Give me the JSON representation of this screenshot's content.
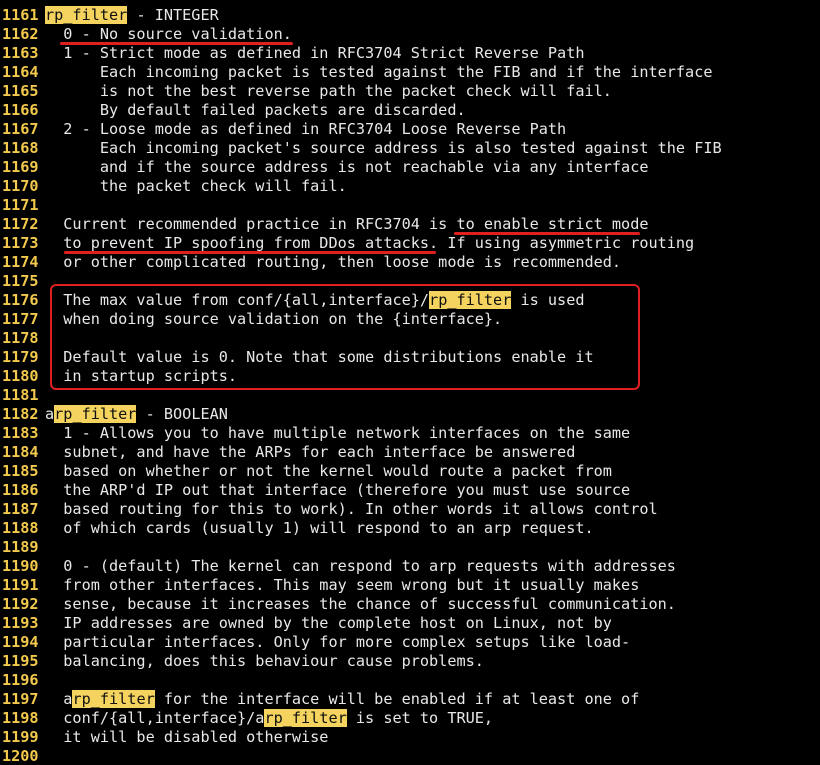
{
  "editor": {
    "accent_line_number_color": "#f2c94c",
    "highlight_color": "#f4d35e",
    "annotation_color": "#e02020",
    "lines": [
      {
        "num": "1161",
        "segments": [
          {
            "t": "rp_filter",
            "hl": true
          },
          {
            "t": " - INTEGER"
          }
        ]
      },
      {
        "num": "1162",
        "segments": [
          {
            "t": "  0 - No source validation."
          }
        ]
      },
      {
        "num": "1163",
        "segments": [
          {
            "t": "  1 - Strict mode as defined in RFC3704 Strict Reverse Path"
          }
        ]
      },
      {
        "num": "1164",
        "segments": [
          {
            "t": "      Each incoming packet is tested against the FIB and if the interface"
          }
        ]
      },
      {
        "num": "1165",
        "segments": [
          {
            "t": "      is not the best reverse path the packet check will fail."
          }
        ]
      },
      {
        "num": "1166",
        "segments": [
          {
            "t": "      By default failed packets are discarded."
          }
        ]
      },
      {
        "num": "1167",
        "segments": [
          {
            "t": "  2 - Loose mode as defined in RFC3704 Loose Reverse Path"
          }
        ]
      },
      {
        "num": "1168",
        "segments": [
          {
            "t": "      Each incoming packet's source address is also tested against the FIB"
          }
        ]
      },
      {
        "num": "1169",
        "segments": [
          {
            "t": "      and if the source address is not reachable via any interface"
          }
        ]
      },
      {
        "num": "1170",
        "segments": [
          {
            "t": "      the packet check will fail."
          }
        ]
      },
      {
        "num": "1171",
        "segments": [
          {
            "t": ""
          }
        ]
      },
      {
        "num": "1172",
        "segments": [
          {
            "t": "  Current recommended practice in RFC3704 is to enable strict mode"
          }
        ]
      },
      {
        "num": "1173",
        "segments": [
          {
            "t": "  to prevent IP spoofing from DDos attacks. If using asymmetric routing"
          }
        ]
      },
      {
        "num": "1174",
        "segments": [
          {
            "t": "  or other complicated routing, then loose mode is recommended."
          }
        ]
      },
      {
        "num": "1175",
        "segments": [
          {
            "t": ""
          }
        ]
      },
      {
        "num": "1176",
        "segments": [
          {
            "t": "  The max value from conf/{all,interface}/"
          },
          {
            "t": "rp_filter",
            "hl": true
          },
          {
            "t": " is used"
          }
        ]
      },
      {
        "num": "1177",
        "segments": [
          {
            "t": "  when doing source validation on the {interface}."
          }
        ]
      },
      {
        "num": "1178",
        "segments": [
          {
            "t": ""
          }
        ]
      },
      {
        "num": "1179",
        "segments": [
          {
            "t": "  Default value is 0. Note that some distributions enable it"
          }
        ]
      },
      {
        "num": "1180",
        "segments": [
          {
            "t": "  in startup scripts."
          }
        ]
      },
      {
        "num": "1181",
        "segments": [
          {
            "t": ""
          }
        ]
      },
      {
        "num": "1182",
        "segments": [
          {
            "t": "a"
          },
          {
            "t": "rp_filter",
            "hl": true
          },
          {
            "t": " - BOOLEAN"
          }
        ]
      },
      {
        "num": "1183",
        "segments": [
          {
            "t": "  1 - Allows you to have multiple network interfaces on the same"
          }
        ]
      },
      {
        "num": "1184",
        "segments": [
          {
            "t": "  subnet, and have the ARPs for each interface be answered"
          }
        ]
      },
      {
        "num": "1185",
        "segments": [
          {
            "t": "  based on whether or not the kernel would route a packet from"
          }
        ]
      },
      {
        "num": "1186",
        "segments": [
          {
            "t": "  the ARP'd IP out that interface (therefore you must use source"
          }
        ]
      },
      {
        "num": "1187",
        "segments": [
          {
            "t": "  based routing for this to work). In other words it allows control"
          }
        ]
      },
      {
        "num": "1188",
        "segments": [
          {
            "t": "  of which cards (usually 1) will respond to an arp request."
          }
        ]
      },
      {
        "num": "1189",
        "segments": [
          {
            "t": ""
          }
        ]
      },
      {
        "num": "1190",
        "segments": [
          {
            "t": "  0 - (default) The kernel can respond to arp requests with addresses"
          }
        ]
      },
      {
        "num": "1191",
        "segments": [
          {
            "t": "  from other interfaces. This may seem wrong but it usually makes"
          }
        ]
      },
      {
        "num": "1192",
        "segments": [
          {
            "t": "  sense, because it increases the chance of successful communication."
          }
        ]
      },
      {
        "num": "1193",
        "segments": [
          {
            "t": "  IP addresses are owned by the complete host on Linux, not by"
          }
        ]
      },
      {
        "num": "1194",
        "segments": [
          {
            "t": "  particular interfaces. Only for more complex setups like load-"
          }
        ]
      },
      {
        "num": "1195",
        "segments": [
          {
            "t": "  balancing, does this behaviour cause problems."
          }
        ]
      },
      {
        "num": "1196",
        "segments": [
          {
            "t": ""
          }
        ]
      },
      {
        "num": "1197",
        "segments": [
          {
            "t": "  a"
          },
          {
            "t": "rp_filter",
            "hl": true
          },
          {
            "t": " for the interface will be enabled if at least one of"
          }
        ]
      },
      {
        "num": "1198",
        "segments": [
          {
            "t": "  conf/{all,interface}/a"
          },
          {
            "t": "rp_filter",
            "hl": true
          },
          {
            "t": " is set to TRUE,"
          }
        ]
      },
      {
        "num": "1199",
        "segments": [
          {
            "t": "  it will be disabled otherwise"
          }
        ]
      },
      {
        "num": "1200",
        "segments": [
          {
            "t": ""
          }
        ]
      }
    ]
  }
}
